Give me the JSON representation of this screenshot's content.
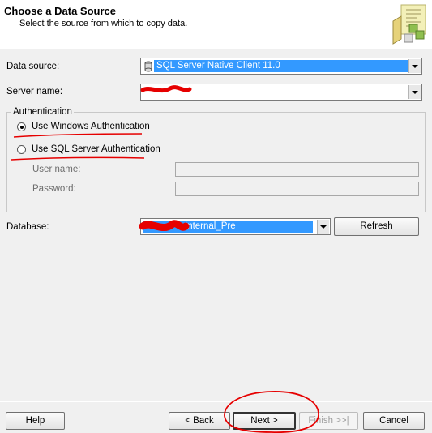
{
  "header": {
    "title": "Choose a Data Source",
    "subtitle": "Select the source from which to copy data."
  },
  "form": {
    "data_source_label": "Data source:",
    "data_source_value": "SQL Server Native Client 11.0",
    "server_name_label": "Server name:",
    "server_name_value": "",
    "auth_group_label": "Authentication",
    "windows_auth_label": "Use Windows Authentication",
    "sql_auth_label": "Use SQL Server Authentication",
    "selected_auth": "windows",
    "user_name_label": "User name:",
    "password_label": "Password:",
    "database_label": "Database:",
    "database_value": "Internal_Pre",
    "refresh_label": "Refresh"
  },
  "footer": {
    "help_label": "Help",
    "back_label": "< Back",
    "next_label": "Next >",
    "finish_label": "Finish >>|",
    "cancel_label": "Cancel"
  },
  "colors": {
    "selection": "#3399ff",
    "annotation": "#e60000",
    "background": "#f0f0f0"
  }
}
